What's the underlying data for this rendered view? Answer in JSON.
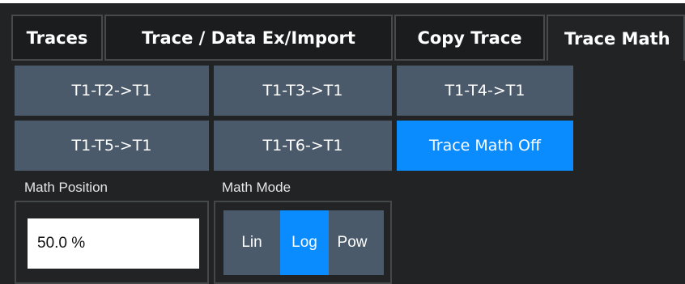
{
  "tabs": [
    {
      "label": "Traces"
    },
    {
      "label": "Trace / Data Ex/Import"
    },
    {
      "label": "Copy Trace"
    },
    {
      "label": "Trace Math"
    }
  ],
  "buttons": [
    {
      "label": "T1-T2->T1"
    },
    {
      "label": "T1-T3->T1"
    },
    {
      "label": "T1-T4->T1"
    },
    {
      "label": "T1-T5->T1"
    },
    {
      "label": "T1-T6->T1"
    },
    {
      "label": "Trace Math Off",
      "active": true
    }
  ],
  "math_position": {
    "label": "Math Position",
    "value": "50.0 %"
  },
  "math_mode": {
    "label": "Math Mode",
    "options": [
      {
        "label": "Lin"
      },
      {
        "label": "Log",
        "active": true
      },
      {
        "label": "Pow"
      }
    ]
  },
  "colors": {
    "accent": "#0a8cff",
    "button": "#4a5a6a",
    "background": "#222324"
  }
}
